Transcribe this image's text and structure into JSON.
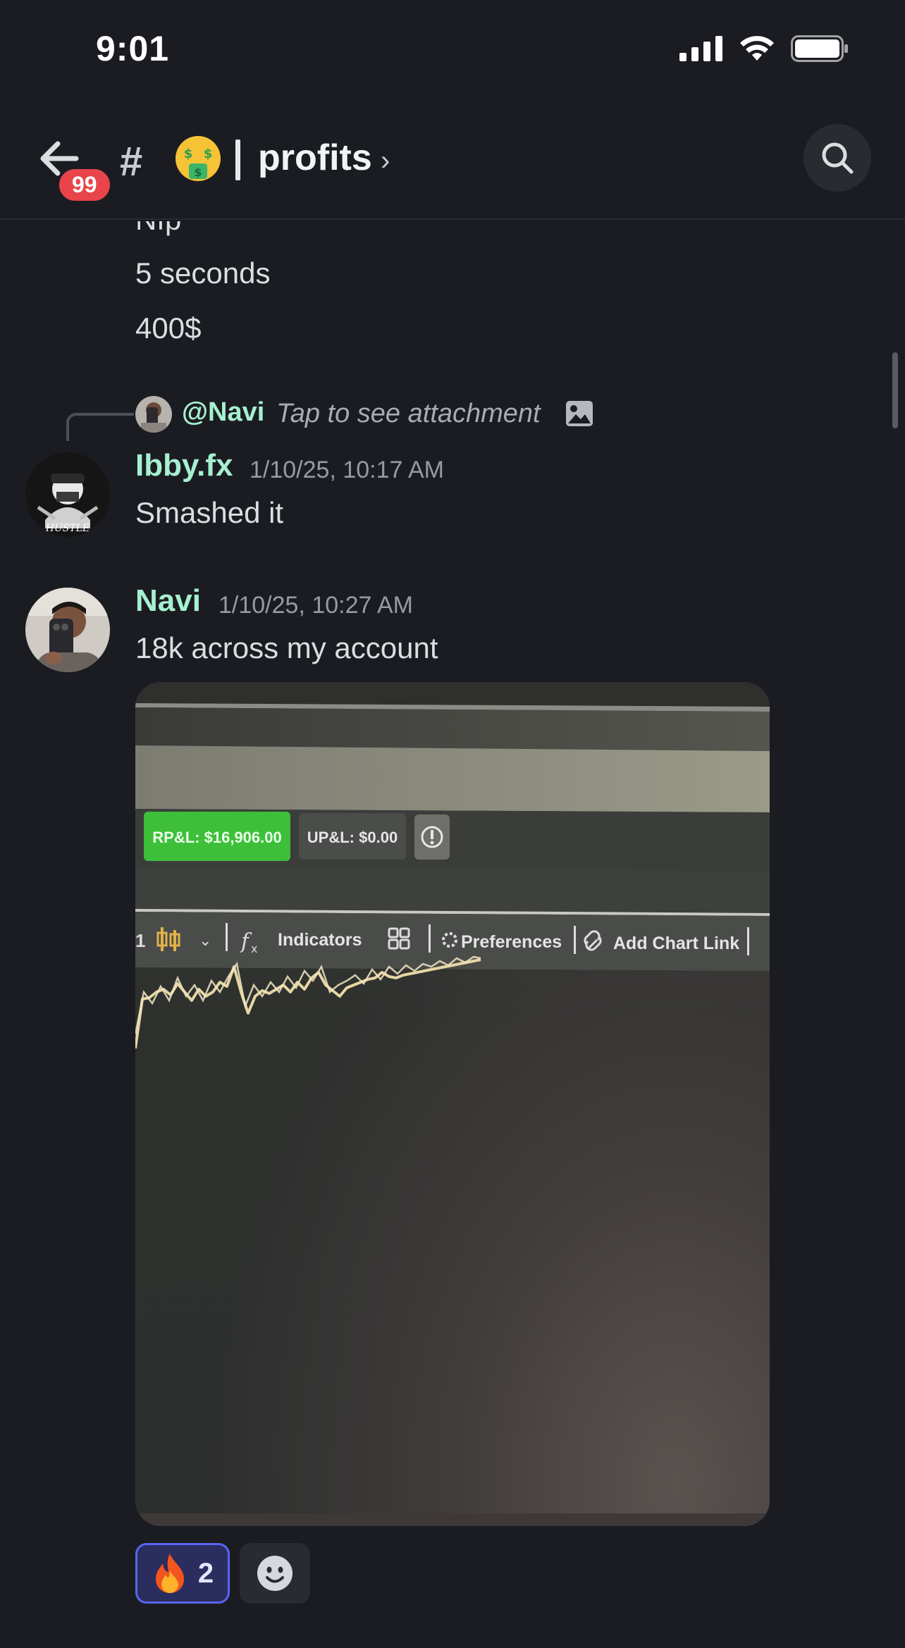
{
  "status_bar": {
    "time": "9:01"
  },
  "header": {
    "unread_badge": "99",
    "hash_symbol": "#",
    "divider": "|",
    "channel_name": "profits",
    "chevron": "›",
    "icons": [
      "back-arrow-icon",
      "money-mouth-face-emoji",
      "search-icon"
    ]
  },
  "messages_top": {
    "partial_line": "Nfp",
    "line1": "5 seconds",
    "line2": "400$"
  },
  "reply": {
    "mention": "@Navi",
    "text": "Tap to see attachment",
    "icon": "image-icon"
  },
  "message1": {
    "username": "Ibby.fx",
    "timestamp": "1/10/25, 10:17 AM",
    "content": "Smashed it",
    "avatar_caption": "HUSTLE"
  },
  "message2": {
    "username": "Navi",
    "timestamp": "1/10/25, 10:27 AM",
    "content": "18k across my account"
  },
  "attachment_photo": {
    "rpl": "RP&L: $16,906.00",
    "upl": "UP&L: $0.00",
    "toolbar": [
      "Indicators",
      "Preferences",
      "Add Chart Link"
    ]
  },
  "reactions": [
    {
      "emoji": "🔥",
      "count": "2"
    }
  ],
  "colors": {
    "background": "#1b1c22",
    "username": "#a6f0cf",
    "badge": "#e8444a",
    "reaction_border": "#5865f2"
  }
}
